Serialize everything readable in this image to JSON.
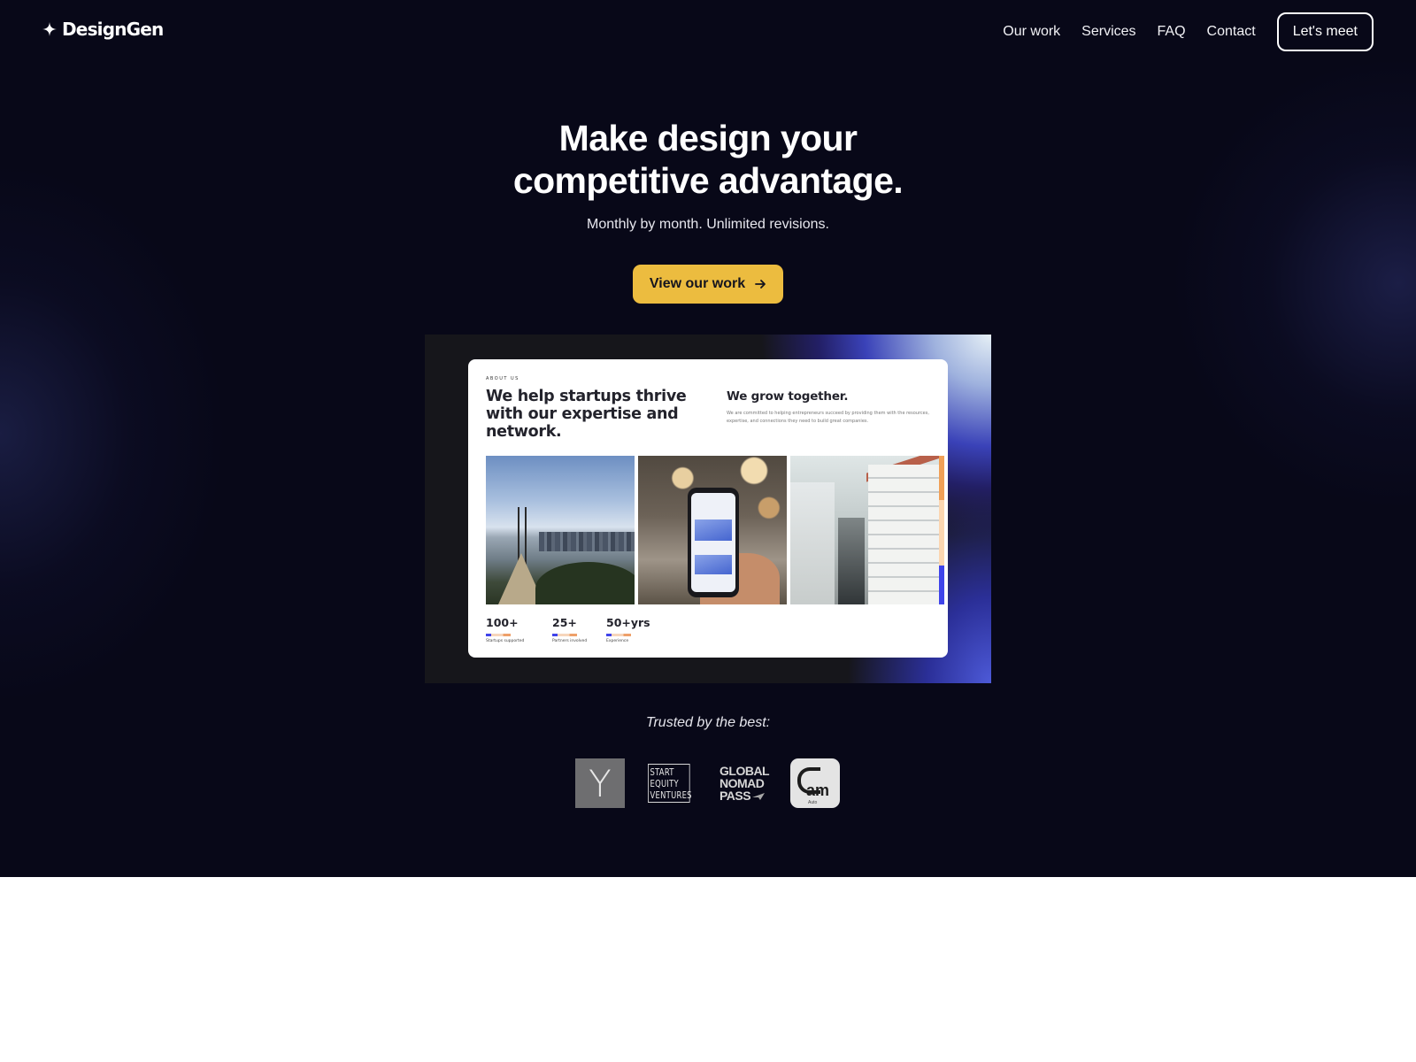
{
  "brand": {
    "name": "DesignGen",
    "logo_icon": "sparkle-icon"
  },
  "nav": {
    "links": [
      "Our work",
      "Services",
      "FAQ",
      "Contact"
    ],
    "cta_label": "Let's meet"
  },
  "hero": {
    "headline_line1": "Make design your",
    "headline_line2": "competitive advantage.",
    "subtitle": "Monthly by month. Unlimited revisions.",
    "cta_label": "View our work",
    "cta_icon": "arrow-right-icon",
    "cta_color": "#ecbc3f",
    "background_color": "#080818"
  },
  "showcase": {
    "eyebrow": "ABOUT US",
    "title": "We help startups thrive with our expertise and network.",
    "side_title": "We grow together.",
    "side_text": "We are committed to helping entrepreneurs succeed by providing them with the resources, expertise, and connections they need to build great companies.",
    "photos": [
      "bridge-city-photo",
      "phone-dashboard-photo",
      "street-buildings-photo"
    ],
    "stats": [
      {
        "value": "100+",
        "label": "Startups supported"
      },
      {
        "value": "25+",
        "label": "Partners involved"
      },
      {
        "value": "50+yrs",
        "label": "Experience"
      }
    ]
  },
  "trusted": {
    "label": "Trusted by the best:",
    "logos": [
      {
        "name": "Y Combinator",
        "text": "Y"
      },
      {
        "name": "Start Equity Ventures",
        "lines": [
          "START",
          "EQUITY",
          "VENTURES"
        ]
      },
      {
        "name": "Global Nomad Pass",
        "lines": [
          "GLOBAL",
          "NOMAD",
          "PASS"
        ]
      },
      {
        "name": "am Auto",
        "text": "am",
        "sub": "Auto"
      }
    ]
  }
}
